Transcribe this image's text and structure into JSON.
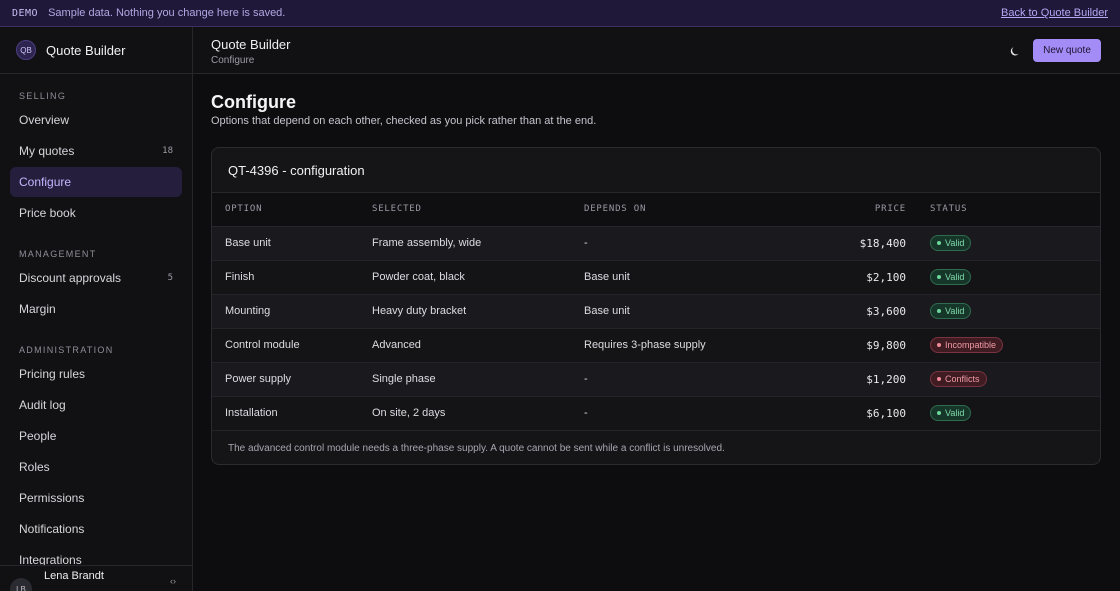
{
  "banner": {
    "tag": "DEMO",
    "message": "Sample data. Nothing you change here is saved.",
    "back_link": "Back to Quote Builder"
  },
  "brand": {
    "initials": "QB",
    "name": "Quote Builder"
  },
  "sidebar": {
    "sections": [
      {
        "title": "SELLING",
        "items": [
          {
            "label": "Overview",
            "count": ""
          },
          {
            "label": "My quotes",
            "count": "18"
          },
          {
            "label": "Configure",
            "count": "",
            "active": true
          },
          {
            "label": "Price book",
            "count": ""
          }
        ]
      },
      {
        "title": "MANAGEMENT",
        "items": [
          {
            "label": "Discount approvals",
            "count": "5"
          },
          {
            "label": "Margin",
            "count": ""
          }
        ]
      },
      {
        "title": "ADMINISTRATION",
        "items": [
          {
            "label": "Pricing rules",
            "count": ""
          },
          {
            "label": "Audit log",
            "count": ""
          },
          {
            "label": "People",
            "count": ""
          },
          {
            "label": "Roles",
            "count": ""
          },
          {
            "label": "Permissions",
            "count": ""
          },
          {
            "label": "Notifications",
            "count": ""
          },
          {
            "label": "Integrations",
            "count": ""
          }
        ]
      }
    ],
    "user": {
      "initials": "LB",
      "name": "Lena Brandt",
      "collapse_icon": "chevrons-icon"
    }
  },
  "header": {
    "title": "Quote Builder",
    "subtitle": "Configure",
    "theme_icon": "moon-icon",
    "new_quote_label": "New quote"
  },
  "main": {
    "title": "Configure",
    "subtitle": "Options that depend on each other, checked as you pick rather than at the end.",
    "card_title": "QT-4396 - configuration",
    "columns": [
      "OPTION",
      "SELECTED",
      "DEPENDS ON",
      "PRICE",
      "STATUS"
    ],
    "rows": [
      {
        "option": "Base unit",
        "selected": "Frame assembly, wide",
        "depends": "-",
        "price": "$18,400",
        "status": "Valid",
        "ok": true
      },
      {
        "option": "Finish",
        "selected": "Powder coat, black",
        "depends": "Base unit",
        "price": "$2,100",
        "status": "Valid",
        "ok": true
      },
      {
        "option": "Mounting",
        "selected": "Heavy duty bracket",
        "depends": "Base unit",
        "price": "$3,600",
        "status": "Valid",
        "ok": true
      },
      {
        "option": "Control module",
        "selected": "Advanced",
        "depends": "Requires 3-phase supply",
        "price": "$9,800",
        "status": "Incompatible",
        "ok": false
      },
      {
        "option": "Power supply",
        "selected": "Single phase",
        "depends": "-",
        "price": "$1,200",
        "status": "Conflicts",
        "ok": false
      },
      {
        "option": "Installation",
        "selected": "On site, 2 days",
        "depends": "-",
        "price": "$6,100",
        "status": "Valid",
        "ok": true
      }
    ],
    "note": "The advanced control module needs a three-phase supply. A quote cannot be sent while a conflict is unresolved."
  },
  "colors": {
    "accent": "#a48cf7",
    "valid": "#6fd69c",
    "error": "#f08a99"
  }
}
